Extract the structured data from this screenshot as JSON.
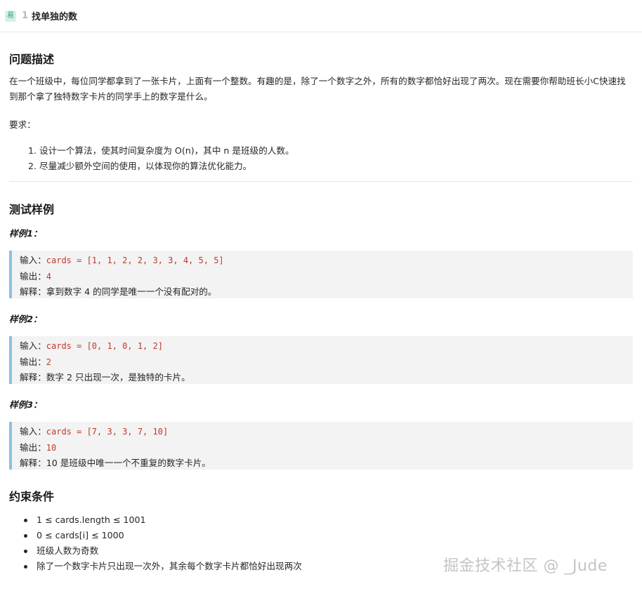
{
  "header": {
    "difficulty": "易",
    "number": "1",
    "title": "找单独的数"
  },
  "description": {
    "heading": "问题描述",
    "paragraph": "在一个班级中，每位同学都拿到了一张卡片，上面有一个整数。有趣的是，除了一个数字之外，所有的数字都恰好出现了两次。现在需要你帮助班长小C快速找到那个拿了独特数字卡片的同学手上的数字是什么。",
    "requirements_label": "要求：",
    "requirements": [
      "1. 设计一个算法，使其时间复杂度为 O(n)，其中 n 是班级的人数。",
      "2. 尽量减少额外空间的使用，以体现你的算法优化能力。"
    ]
  },
  "tests": {
    "heading": "测试样例",
    "examples": [
      {
        "title": "样例1：",
        "input_label": "输入：",
        "input": "cards = [1, 1, 2, 2, 3, 3, 4, 5, 5]",
        "output_label": "输出：",
        "output": "4",
        "explain_label": "解释：",
        "explain": "拿到数字 4 的同学是唯一一个没有配对的。"
      },
      {
        "title": "样例2：",
        "input_label": "输入：",
        "input": "cards = [0, 1, 0, 1, 2]",
        "output_label": "输出：",
        "output": "2",
        "explain_label": "解释：",
        "explain": "数字 2 只出现一次，是独特的卡片。"
      },
      {
        "title": "样例3：",
        "input_label": "输入：",
        "input": "cards = [7, 3, 3, 7, 10]",
        "output_label": "输出：",
        "output": "10",
        "explain_label": "解释：",
        "explain": "10 是班级中唯一一个不重复的数字卡片。"
      }
    ]
  },
  "constraints": {
    "heading": "约束条件",
    "items": [
      "1 ≤ cards.length ≤ 1001",
      "0 ≤ cards[i] ≤ 1000",
      "班级人数为奇数",
      "除了一个数字卡片只出现一次外，其余每个数字卡片都恰好出现两次"
    ]
  },
  "watermark": "掘金技术社区 @ _Jude"
}
